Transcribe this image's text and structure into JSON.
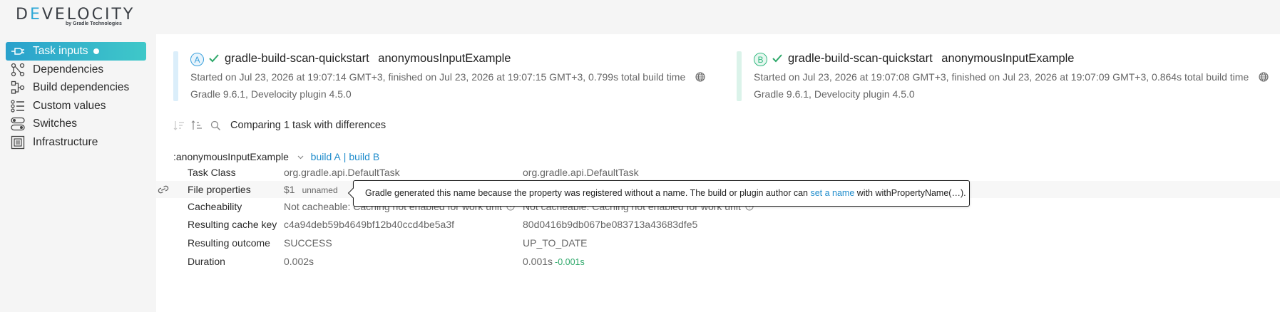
{
  "app": {
    "logo_text_1": "D",
    "logo_text_accent": "E",
    "logo_text_2": "VELOCITY",
    "logo_sub": "by Gradle Technologies"
  },
  "sidebar": {
    "items": [
      {
        "label": "Task inputs",
        "icon": "plug-icon",
        "active": true
      },
      {
        "label": "Dependencies",
        "icon": "dependency-tree-icon",
        "active": false
      },
      {
        "label": "Build dependencies",
        "icon": "build-dependency-icon",
        "active": false
      },
      {
        "label": "Custom values",
        "icon": "list-icon",
        "active": false
      },
      {
        "label": "Switches",
        "icon": "toggle-icon",
        "active": false
      },
      {
        "label": "Infrastructure",
        "icon": "server-icon",
        "active": false
      }
    ]
  },
  "builds": {
    "a": {
      "badge": "A",
      "project": "gradle-build-scan-quickstart",
      "task": "anonymousInputExample",
      "timing": "Started on Jul 23, 2026 at 19:07:14 GMT+3, finished on Jul 23, 2026 at 19:07:15 GMT+3, 0.799s total build time",
      "versions": "Gradle 9.6.1, Develocity plugin 4.5.0"
    },
    "b": {
      "badge": "B",
      "project": "gradle-build-scan-quickstart",
      "task": "anonymousInputExample",
      "timing": "Started on Jul 23, 2026 at 19:07:08 GMT+3, finished on Jul 23, 2026 at 19:07:09 GMT+3, 0.864s total build time",
      "versions": "Gradle 9.6.1, Develocity plugin 4.5.0"
    }
  },
  "toolbar": {
    "compare_prefix": "Comparing ",
    "compare_count": "1",
    "compare_suffix": " task with differences"
  },
  "task": {
    "name": ":anonymousInputExample",
    "link_a": "build A",
    "separator": "|",
    "link_b": "build B"
  },
  "rows": {
    "task_class": {
      "label": "Task Class",
      "a": "org.gradle.api.DefaultTask",
      "b": "org.gradle.api.DefaultTask"
    },
    "file_properties": {
      "label": "File properties",
      "a": "$1",
      "a_tag": "unnamed"
    },
    "cacheability": {
      "label": "Cacheability",
      "a": "Not cacheable: Caching not enabled for work unit",
      "b": "Not cacheable: Caching not enabled for work unit"
    },
    "cache_key": {
      "label": "Resulting cache key",
      "a": "c4a94deb59b4649bf12b40ccd4be5a3f",
      "b": "80d0416b9db067be083713a43683dfe5"
    },
    "outcome": {
      "label": "Resulting outcome",
      "a": "SUCCESS",
      "b": "UP_TO_DATE"
    },
    "duration": {
      "label": "Duration",
      "a": "0.002s",
      "b": "0.001s",
      "b_diff": "-0.001s"
    }
  },
  "tooltip": {
    "prefix": "Gradle generated this name because the property was registered without a name. The build or plugin author can ",
    "link": "set a name",
    "suffix": " with withPropertyName(…)."
  },
  "colors": {
    "accent_start": "#2aa1cc",
    "accent_end": "#3fc8c9",
    "build_a": "#3aa0dc",
    "build_b": "#33b981",
    "link": "#1f8ccc",
    "diff_green": "#2ea86a"
  }
}
